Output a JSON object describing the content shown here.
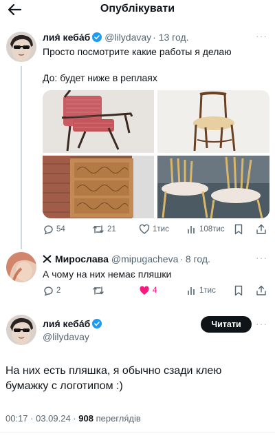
{
  "header": {
    "title": "Опублікувати"
  },
  "tweet1": {
    "name": "лия́ кеба́б",
    "handle": "@lilydavay",
    "time": "· 13 год.",
    "text_line1": "Просто посмотрите какие работы я делаю",
    "text_line2": "До: будет ниже в реплаях",
    "replies": "54",
    "retweets": "21",
    "likes": "1тис",
    "views": "108тис"
  },
  "tweet2": {
    "name": "Мирослава",
    "handle": "@mipugacheva",
    "time": "· 8 год.",
    "text": "А чому на них немає пляшки",
    "replies": "2",
    "likes": "4",
    "views": "1тис"
  },
  "main": {
    "name": "лия́ кеба́б",
    "handle": "@lilydavay",
    "follow_label": "Читати",
    "text": "На них есть пляшка, я обычно сзади клею бумажку с логотипом :)",
    "time": "00:17 · 03.09.24 ·",
    "views_count": "908",
    "views_label": "перегля́дів"
  },
  "colors": {
    "accent": "#1d9bf0",
    "like": "#f91880",
    "text": "#0f1419",
    "muted": "#536471"
  }
}
